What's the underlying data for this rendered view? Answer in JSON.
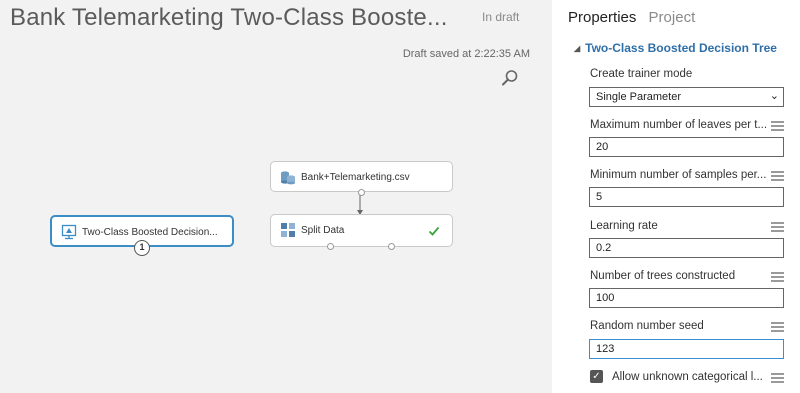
{
  "experiment": {
    "title": "Bank Telemarketing Two-Class Booste...",
    "status": "In draft",
    "draft_saved": "Draft saved at 2:22:35 AM"
  },
  "modules": {
    "dataset": {
      "label": "Bank+Telemarketing.csv"
    },
    "split": {
      "label": "Split Data"
    },
    "boosted": {
      "label": "Two-Class Boosted Decision...",
      "badge": "1"
    }
  },
  "icons": {
    "search": "search-icon",
    "dataset": "dataset-icon",
    "split": "split-data-icon",
    "model": "model-icon",
    "success": "checkmark-icon"
  },
  "panel": {
    "tabs": [
      {
        "label": "Properties"
      },
      {
        "label": "Project"
      }
    ],
    "section_title": "Two-Class Boosted Decision Tree",
    "create_trainer_mode": {
      "label": "Create trainer mode",
      "value": "Single Parameter"
    },
    "max_leaves": {
      "label": "Maximum number of leaves per t...",
      "value": "20"
    },
    "min_samples": {
      "label": "Minimum number of samples per...",
      "value": "5"
    },
    "learning_rate": {
      "label": "Learning rate",
      "value": "0.2"
    },
    "num_trees": {
      "label": "Number of trees constructed",
      "value": "100"
    },
    "random_seed": {
      "label": "Random number seed",
      "value": "123"
    },
    "allow_unknown": {
      "label": "Allow unknown categorical l...",
      "checked": true
    }
  },
  "colors": {
    "accent": "#2f6fa8",
    "selected_border": "#3c8dc5",
    "success": "#3aa53a",
    "canvas_bg": "#f2f2f2"
  }
}
